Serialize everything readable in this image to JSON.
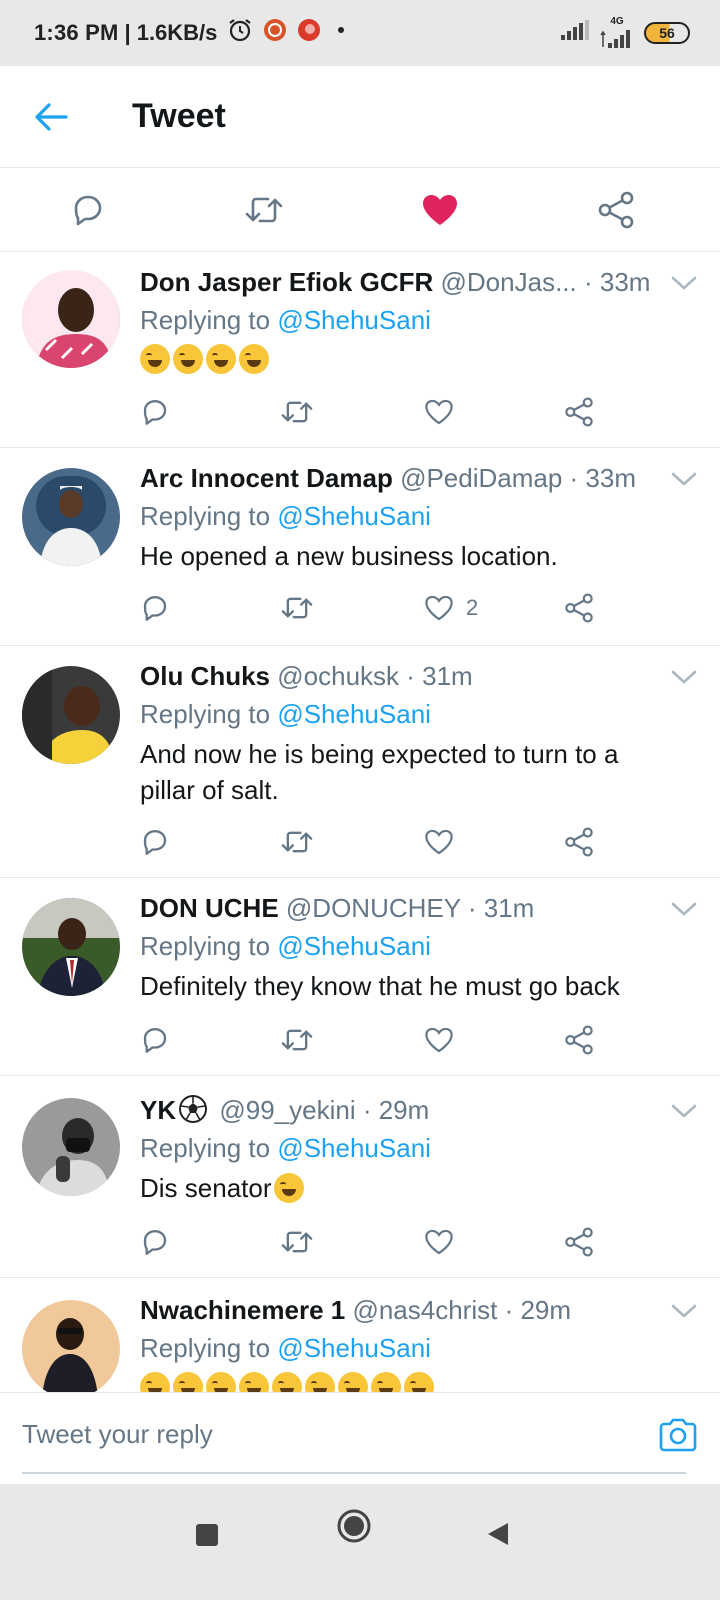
{
  "status_bar": {
    "time": "1:36 PM",
    "separator": "|",
    "speed": "1.6KB/s",
    "network": "4G",
    "battery": "56"
  },
  "header": {
    "title": "Tweet"
  },
  "colors": {
    "accent": "#1da1f2",
    "like": "#e0245e",
    "secondary_text": "#657786"
  },
  "replies": [
    {
      "name": "Don Jasper Efiok GCFR",
      "handle": "@DonJas...",
      "time": " · 33m",
      "replying_label": "Replying to ",
      "mention": "@ShehuSani",
      "text": "",
      "emojis": 4,
      "likes": ""
    },
    {
      "name": "Arc Innocent Damap",
      "handle": "@PediDamap",
      "time": " · 33m",
      "replying_label": "Replying to ",
      "mention": "@ShehuSani",
      "text": "He opened a new business location.",
      "likes": "2"
    },
    {
      "name": "Olu Chuks",
      "handle": "@ochuksk",
      "time": " · 31m",
      "replying_label": "Replying to ",
      "mention": "@ShehuSani",
      "text": "And now he is being expected to turn to a pillar of salt.",
      "likes": ""
    },
    {
      "name": "DON UCHE",
      "handle": "@DONUCHEY",
      "time": " · 31m",
      "replying_label": "Replying to ",
      "mention": "@ShehuSani",
      "text": "Definitely they know that he must go back",
      "likes": ""
    },
    {
      "name": "YK",
      "handle": "@99_yekini",
      "time": " · 29m",
      "replying_label": "Replying to ",
      "mention": "@ShehuSani",
      "text": "Dis senator",
      "likes": ""
    },
    {
      "name": "Nwachinemere 1",
      "handle": "@nas4christ",
      "time": " · 29m",
      "replying_label": "Replying to ",
      "mention": "@ShehuSani",
      "text": "",
      "emojis": 9,
      "likes": ""
    }
  ],
  "composer": {
    "placeholder": "Tweet your reply"
  }
}
